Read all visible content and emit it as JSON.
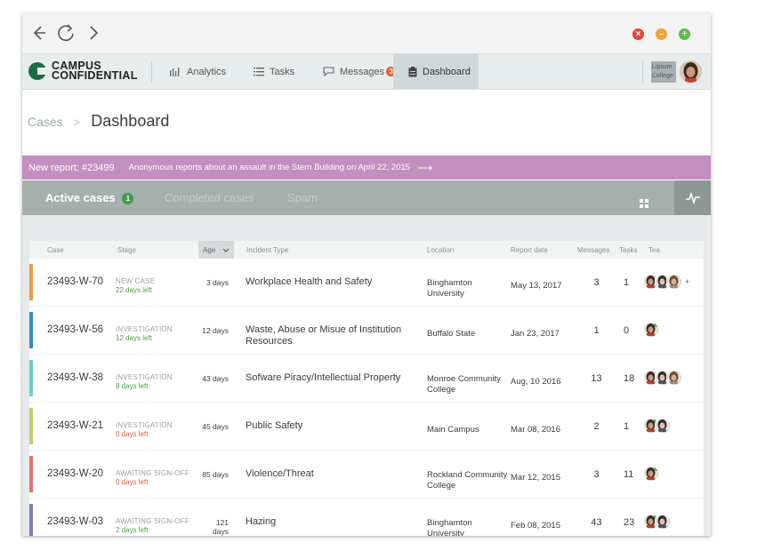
{
  "browser": {
    "icons": [
      "back-arrow-icon",
      "reload-icon",
      "forward-arrow-icon"
    ],
    "window_buttons": {
      "close": "#e0443c",
      "minimize": "#f2a23a",
      "maximize": "#5dbb4d"
    }
  },
  "app": {
    "logo_line1": "CAMPUS",
    "logo_line2": "CONFIDENTIAL",
    "nav": [
      {
        "label": "Analytics",
        "icon": "bar-chart-icon"
      },
      {
        "label": "Tasks",
        "icon": "list-icon"
      },
      {
        "label": "Messages",
        "icon": "message-icon",
        "badge": "3"
      },
      {
        "label": "Dashboard",
        "icon": "clipboard-icon",
        "active": true
      }
    ],
    "college_logo": "Lipsum College"
  },
  "breadcrumb": {
    "parent": "Cases",
    "separator": ">",
    "current": "Dashboard"
  },
  "banner": {
    "report_id": "New report: #23499",
    "message": "Anonymous reports about an assault in the Stern Building on April 22, 2015",
    "arrow": "⟶",
    "color": "#c28fbe"
  },
  "tabs": [
    {
      "label": "Active cases",
      "badge": "1",
      "active": true
    },
    {
      "label": "Completed cases",
      "active": false
    },
    {
      "label": "Spam",
      "active": false
    }
  ],
  "table": {
    "headers": {
      "case": "Case",
      "stage": "Stage",
      "age": "Age",
      "incident": "Incident Type",
      "location": "Location",
      "date": "Report date",
      "messages": "Messages",
      "tasks": "Tasks",
      "team": "Tea"
    },
    "rows": [
      {
        "case": "23493-W-70",
        "stage": "NEW CASE",
        "days_left": "22 days left",
        "days_left_status": "ok",
        "age": "3 days",
        "incident": "Workplace Health and Safety",
        "location": "Binghamton University",
        "date": "May 13, 2017",
        "messages": "3",
        "tasks": "1",
        "stripe": "#f39a4a",
        "team_count": 3,
        "extra": "+"
      },
      {
        "case": "23493-W-56",
        "stage": "INVESTIGATION",
        "days_left": "12 days left",
        "days_left_status": "ok",
        "age": "12 days",
        "incident": "Waste, Abuse or Misue of Institution Resources",
        "location": "Buffalo State",
        "date": "Jan 23, 2017",
        "messages": "1",
        "tasks": "0",
        "stripe": "#2f8fc3",
        "team_count": 1,
        "extra": ""
      },
      {
        "case": "23493-W-38",
        "stage": "INVESTIGATION",
        "days_left": "8 days left",
        "days_left_status": "ok",
        "age": "43 days",
        "incident": "Sofware Piracy/Intellectual Property",
        "location": "Monroe Community College",
        "date": "Aug, 10 2016",
        "messages": "13",
        "tasks": "18",
        "stripe": "#6fcdc9",
        "team_count": 3,
        "extra": ""
      },
      {
        "case": "23493-W-21",
        "stage": "INVESTIGATION",
        "days_left": "0 days left",
        "days_left_status": "overdue",
        "age": "45 days",
        "incident": "Public Safety",
        "location": "Main Campus",
        "date": "Mar 08, 2016",
        "messages": "2",
        "tasks": "1",
        "stripe": "#c2cf6a",
        "team_count": 2,
        "extra": ""
      },
      {
        "case": "23493-W-20",
        "stage": "AWAITING SIGN-OFF",
        "days_left": "0 days left",
        "days_left_status": "overdue",
        "age": "85 days",
        "incident": "Violence/Threat",
        "location": "Rockland Community  College",
        "date": "Mar 12, 2015",
        "messages": "3",
        "tasks": "11",
        "stripe": "#e2706f",
        "team_count": 1,
        "extra": ""
      },
      {
        "case": "23493-W-03",
        "stage": "AWAITING SIGN-OFF",
        "days_left": "2 days left",
        "days_left_status": "ok",
        "age": "121 days",
        "incident": "Hazing",
        "location": "Binghamton University",
        "date": "Feb 08, 2015",
        "messages": "43",
        "tasks": "23",
        "stripe": "#7d7fb8",
        "team_count": 2,
        "extra": ""
      }
    ]
  }
}
